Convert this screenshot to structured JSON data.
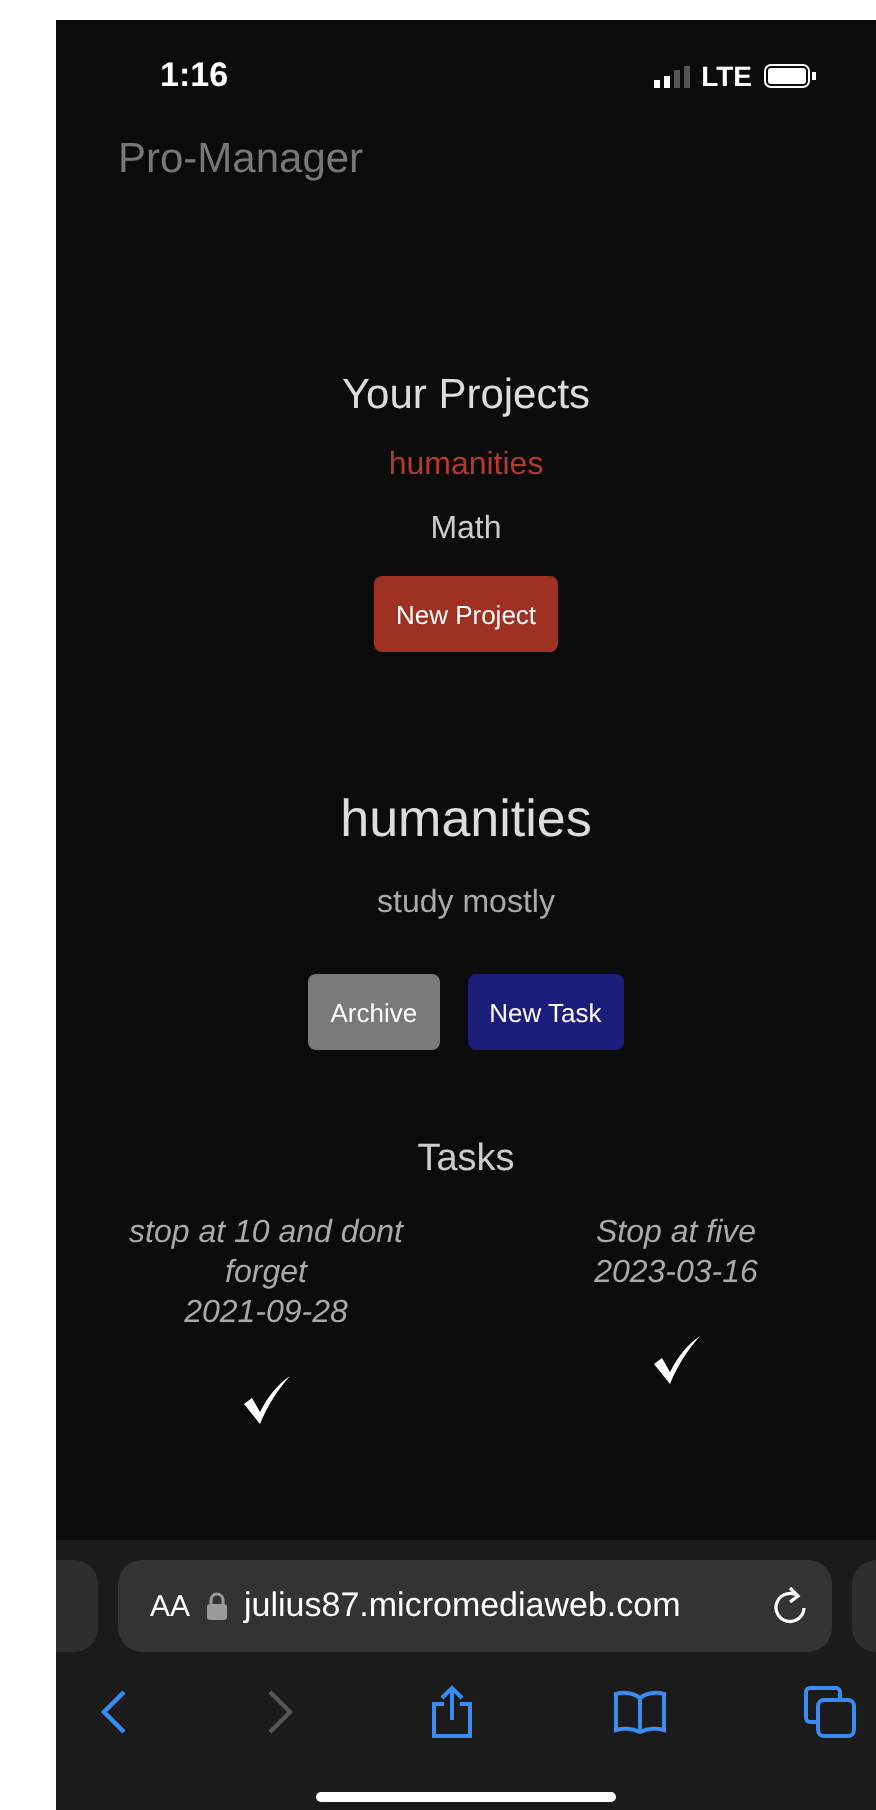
{
  "status_bar": {
    "time": "1:16",
    "network": "LTE"
  },
  "brand": "Pro-Manager",
  "projects": {
    "title": "Your Projects",
    "items": [
      {
        "name": "humanities",
        "selected": true
      },
      {
        "name": "Math",
        "selected": false
      }
    ],
    "new_button": "New Project"
  },
  "project": {
    "name": "humanities",
    "description": "study mostly",
    "archive_button": "Archive",
    "new_task_button": "New Task"
  },
  "tasks": {
    "title": "Tasks",
    "items": [
      {
        "text": "stop at 10 and dont forget",
        "date": "2021-09-28",
        "done": true
      },
      {
        "text": "Stop at five",
        "date": "2023-03-16",
        "done": true
      }
    ]
  },
  "browser": {
    "text_size": "AA",
    "url": "julius87.micromediaweb.com",
    "forward_disabled": true
  }
}
